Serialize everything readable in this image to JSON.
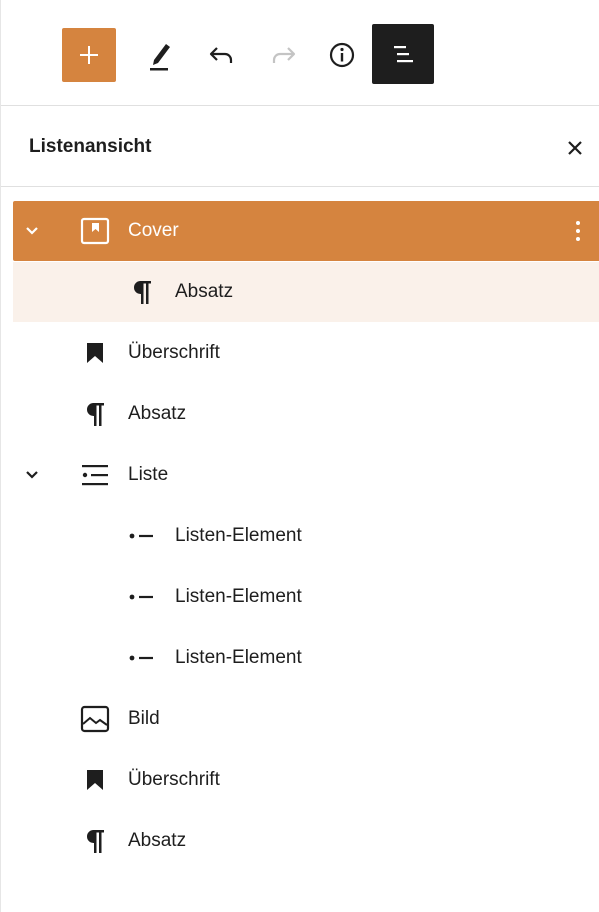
{
  "toolbar": {
    "buttons": [
      {
        "name": "add-block-button",
        "icon": "plus-icon"
      },
      {
        "name": "tools-button",
        "icon": "pencil-icon"
      },
      {
        "name": "undo-button",
        "icon": "undo-icon"
      },
      {
        "name": "redo-button",
        "icon": "redo-icon"
      },
      {
        "name": "details-button",
        "icon": "info-icon"
      },
      {
        "name": "list-view-button",
        "icon": "list-view-icon"
      }
    ]
  },
  "panel": {
    "title": "Listenansicht",
    "close_icon": "close-icon"
  },
  "tree": {
    "items": [
      {
        "label": "Cover",
        "icon": "cover-icon",
        "expanded": true,
        "selected": true
      },
      {
        "label": "Absatz",
        "icon": "paragraph-icon"
      },
      {
        "label": "Überschrift",
        "icon": "heading-icon"
      },
      {
        "label": "Absatz",
        "icon": "paragraph-icon"
      },
      {
        "label": "Liste",
        "icon": "list-icon",
        "expanded": true
      },
      {
        "label": "Listen-Element",
        "icon": "list-item-icon"
      },
      {
        "label": "Listen-Element",
        "icon": "list-item-icon"
      },
      {
        "label": "Listen-Element",
        "icon": "list-item-icon"
      },
      {
        "label": "Bild",
        "icon": "image-icon"
      },
      {
        "label": "Überschrift",
        "icon": "heading-icon"
      },
      {
        "label": "Absatz",
        "icon": "paragraph-icon"
      }
    ]
  },
  "colors": {
    "accent": "#d5843f",
    "accent_light": "#faf1ea",
    "text": "#1e1e1e",
    "disabled": "#c4c4c4",
    "active_toggle_bg": "#1e1e1e"
  }
}
